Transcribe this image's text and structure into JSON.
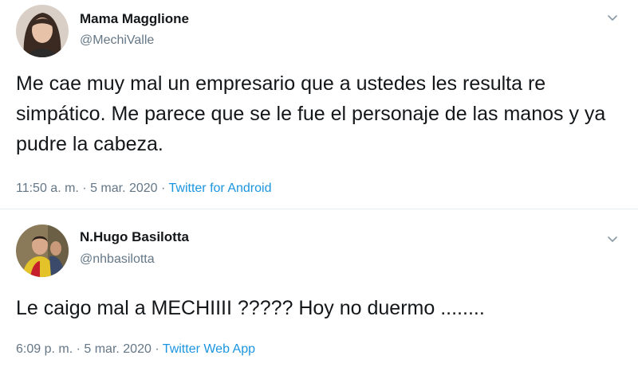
{
  "tweets": [
    {
      "name": "Mama Magglione",
      "handle": "@MechiValle",
      "text": "Me cae muy mal un empresario que a ustedes les resulta re simpático. Me parece que se le fue el personaje de las manos y ya pudre la cabeza.",
      "time": "11:50 a. m. · 5 mar. 2020 · ",
      "source": "Twitter for Android",
      "avatar_icon": "woman-profile-photo",
      "menu_icon": "chevron-down-icon"
    },
    {
      "name": "N.Hugo Basilotta",
      "handle": "@nhbasilotta",
      "text": "Le caigo mal a MECHIIII ????? Hoy no duermo ........",
      "time": "6:09 p. m. · 5 mar. 2020 · ",
      "source": "Twitter Web App",
      "avatar_icon": "man-profile-photo",
      "menu_icon": "chevron-down-icon"
    }
  ],
  "colors": {
    "text": "#14171a",
    "secondary": "#657786",
    "link": "#1b95e0",
    "divider": "#e6ecf0"
  }
}
